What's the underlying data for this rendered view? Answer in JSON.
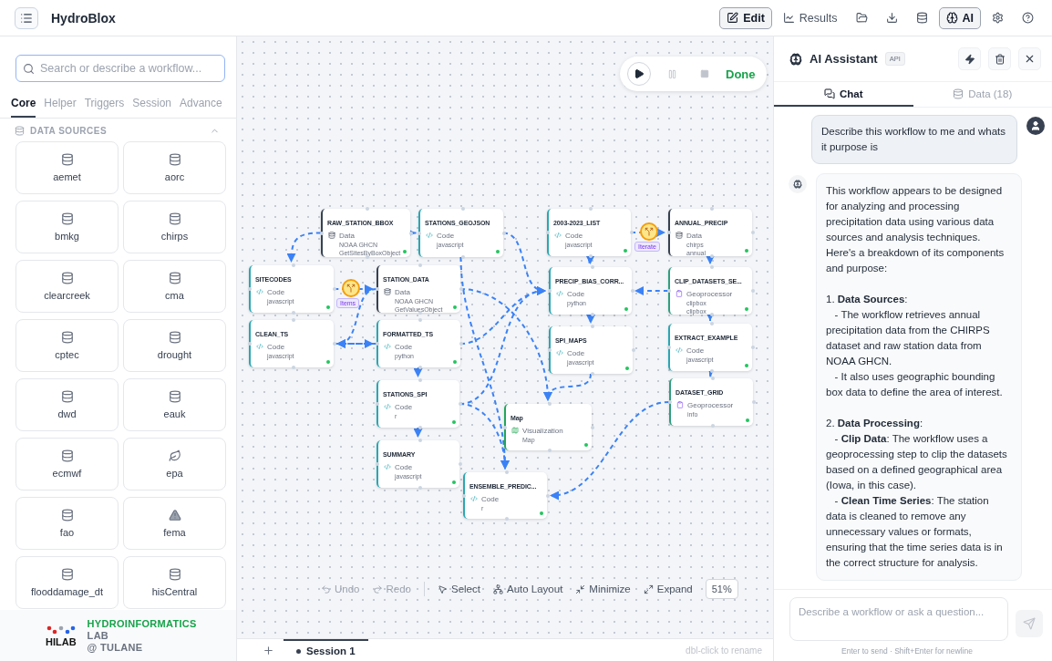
{
  "app": {
    "title": "HydroBlox"
  },
  "toolbar": [
    {
      "kind": "edit",
      "label": "Edit",
      "selected": true
    },
    {
      "kind": "results",
      "label": "Results",
      "selected": false
    },
    {
      "kind": "open",
      "selected": false
    },
    {
      "kind": "download",
      "selected": false
    },
    {
      "kind": "data",
      "selected": false
    },
    {
      "kind": "ai",
      "label": "AI",
      "selected": true
    },
    {
      "kind": "settings",
      "selected": false
    },
    {
      "kind": "help",
      "selected": false
    }
  ],
  "sidebar": {
    "search": {
      "placeholder": "Search or describe a workflow..."
    },
    "tabs": [
      {
        "label": "Core",
        "selected": true
      },
      {
        "label": "Helper",
        "selected": false
      },
      {
        "label": "Triggers",
        "selected": false
      },
      {
        "label": "Session",
        "selected": false
      },
      {
        "label": "Advance",
        "selected": false
      }
    ],
    "section": {
      "title": "DATA SOURCES",
      "expanded": true
    },
    "items": [
      {
        "label": "aemet",
        "kind": "database"
      },
      {
        "label": "aorc",
        "kind": "database"
      },
      {
        "label": "bmkg",
        "kind": "database"
      },
      {
        "label": "chirps",
        "kind": "database"
      },
      {
        "label": "clearcreek",
        "kind": "database"
      },
      {
        "label": "cma",
        "kind": "database"
      },
      {
        "label": "cptec",
        "kind": "database"
      },
      {
        "label": "drought",
        "kind": "database"
      },
      {
        "label": "dwd",
        "kind": "database"
      },
      {
        "label": "eauk",
        "kind": "database"
      },
      {
        "label": "ecmwf",
        "kind": "database"
      },
      {
        "label": "epa",
        "kind": "leaf"
      },
      {
        "label": "fao",
        "kind": "database"
      },
      {
        "label": "fema",
        "kind": "warning"
      },
      {
        "label": "flooddamage_dt",
        "kind": "database"
      },
      {
        "label": "hisCentral",
        "kind": "database"
      }
    ],
    "footer": {
      "logo": "HILAB",
      "lines": [
        "HYDROINFORMATICS",
        "LAB",
        "@ TULANE"
      ]
    }
  },
  "run_controls": {
    "status": "Done"
  },
  "canvas": {
    "nodes": [
      {
        "title": "RAW_STATION_BBOX",
        "kind": "data",
        "type": "Data",
        "details": [
          "NOAA GHCN",
          "GetSitesByBoxObject"
        ]
      },
      {
        "title": "STATIONS_GEOJSON",
        "kind": "code",
        "type": "Code",
        "details": [
          "javascript"
        ]
      },
      {
        "title": "2003-2023_LIST",
        "kind": "code",
        "type": "Code",
        "details": [
          "javascript"
        ]
      },
      {
        "title": "ANNUAL_PRECIP",
        "kind": "data",
        "type": "Data",
        "details": [
          "chirps",
          "annual"
        ]
      },
      {
        "title": "SITECODES",
        "kind": "code",
        "type": "Code",
        "details": [
          "javascript"
        ]
      },
      {
        "title": "STATION_DATA",
        "kind": "data",
        "type": "Data",
        "details": [
          "NOAA GHCN",
          "GetValuesObject"
        ]
      },
      {
        "title": "PRECIP_BIAS_CORR...",
        "kind": "code",
        "type": "Code",
        "details": [
          "python"
        ]
      },
      {
        "title": "CLIP_DATASETS_SE...",
        "kind": "geoprocessor",
        "type": "Geoprocessor",
        "details": [
          "clipbox",
          "clipbox"
        ]
      },
      {
        "title": "CLEAN_TS",
        "kind": "code",
        "type": "Code",
        "details": [
          "javascript"
        ]
      },
      {
        "title": "FORMATTED_TS",
        "kind": "code",
        "type": "Code",
        "details": [
          "python"
        ]
      },
      {
        "title": "SPI_MAPS",
        "kind": "code",
        "type": "Code",
        "details": [
          "javascript"
        ]
      },
      {
        "title": "EXTRACT_EXAMPLE",
        "kind": "code",
        "type": "Code",
        "details": [
          "javascript"
        ]
      },
      {
        "title": "STATIONS_SPI",
        "kind": "code",
        "type": "Code",
        "details": [
          "r"
        ]
      },
      {
        "title": "DATASET_GRID",
        "kind": "geoprocessor",
        "type": "Geoprocessor",
        "details": [
          "info"
        ]
      },
      {
        "title": "Map",
        "kind": "visualization",
        "type": "Visualization",
        "details": [
          "Map"
        ]
      },
      {
        "title": "SUMMARY",
        "kind": "code",
        "type": "Code",
        "details": [
          "javascript"
        ]
      },
      {
        "title": "ENSEMBLE_PREDIC...",
        "kind": "code",
        "type": "Code",
        "details": [
          "r"
        ]
      }
    ],
    "edge_badges": [
      {
        "label": "Items"
      },
      {
        "label": "Iterate"
      }
    ]
  },
  "canvas_toolbar": [
    {
      "kind": "undo",
      "label": "Undo",
      "disabled": true
    },
    {
      "kind": "redo",
      "label": "Redo",
      "disabled": true
    },
    {
      "kind": "select",
      "label": "Select",
      "disabled": false
    },
    {
      "kind": "layout",
      "label": "Auto Layout",
      "disabled": false
    },
    {
      "kind": "minimize",
      "label": "Minimize",
      "disabled": false
    },
    {
      "kind": "expand",
      "label": "Expand",
      "disabled": false
    }
  ],
  "zoom": "51%",
  "sessions": {
    "tabs": [
      {
        "label": "Session 1",
        "selected": true
      }
    ],
    "hint": "dbl-click to rename"
  },
  "assistant": {
    "title": "AI Assistant",
    "badge": "API",
    "tabs": [
      {
        "kind": "chat",
        "label": "Chat",
        "selected": true
      },
      {
        "kind": "data",
        "label": "Data (18)",
        "selected": false
      }
    ],
    "messages": [
      {
        "kind": "user",
        "paragraphs": [
          "Describe this workflow to me and whats it purpose is"
        ]
      },
      {
        "kind": "assistant",
        "paragraphs": [
          "This workflow appears to be designed for analyzing and processing precipitation data using various data sources and analysis techniques. Here's a breakdown of its components and purpose:",
          "1. **Data Sources**:\n   - The workflow retrieves annual precipitation data from the CHIRPS dataset and raw station data from NOAA GHCN.\n   - It also uses geographic bounding box data to define the area of interest.",
          "2. **Data Processing**:\n   - **Clip Data**: The workflow uses a geoprocessing step to clip the datasets based on a defined geographical area (Iowa, in this case).\n   - **Clean Time Series**: The station data is cleaned to remove any unnecessary values or formats, ensuring that the time series data is in the correct structure for analysis."
        ]
      }
    ],
    "input": {
      "placeholder": "Describe a workflow or ask a question..."
    },
    "send_disabled": true,
    "hint": "Enter to send · Shift+Enter for newline"
  }
}
